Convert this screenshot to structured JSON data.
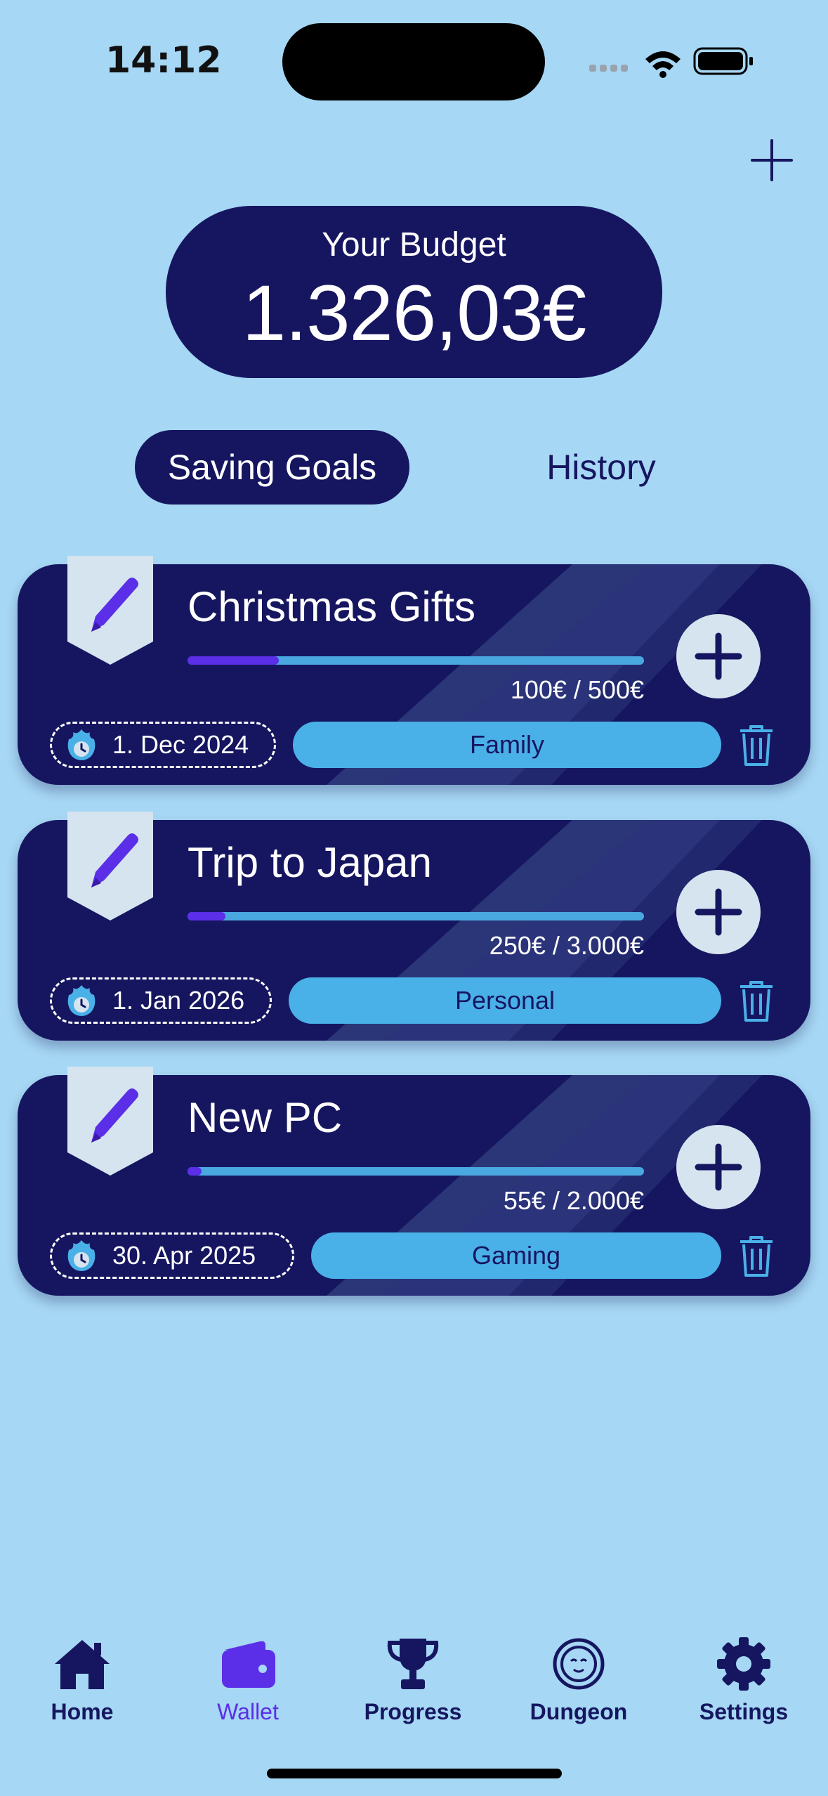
{
  "status_bar": {
    "time": "14:12"
  },
  "header": {
    "add_icon": "plus-icon"
  },
  "budget": {
    "label": "Your Budget",
    "amount": "1.326,03€"
  },
  "segments": {
    "saving_goals": "Saving Goals",
    "history": "History",
    "active": "saving_goals"
  },
  "goals": [
    {
      "title": "Christmas Gifts",
      "amount": "100€ / 500€",
      "progress": 0.2,
      "due": "1. Dec 2024",
      "category": "Family"
    },
    {
      "title": "Trip to Japan",
      "amount": "250€ / 3.000€",
      "progress": 0.083,
      "due": "1. Jan 2026",
      "category": "Personal"
    },
    {
      "title": "New PC",
      "amount": "55€ / 2.000€",
      "progress": 0.028,
      "due": "30. Apr 2025",
      "category": "Gaming"
    }
  ],
  "tab_bar": {
    "items": [
      {
        "label": "Home",
        "icon": "house-icon"
      },
      {
        "label": "Wallet",
        "icon": "wallet-icon"
      },
      {
        "label": "Progress",
        "icon": "trophy-icon"
      },
      {
        "label": "Dungeon",
        "icon": "dungeon-face-icon"
      },
      {
        "label": "Settings",
        "icon": "gear-icon"
      }
    ],
    "active": "Wallet"
  },
  "colors": {
    "background": "#a6d7f4",
    "navy": "#161660",
    "accent": "#5b2ee8",
    "category": "#4ab0e8"
  }
}
